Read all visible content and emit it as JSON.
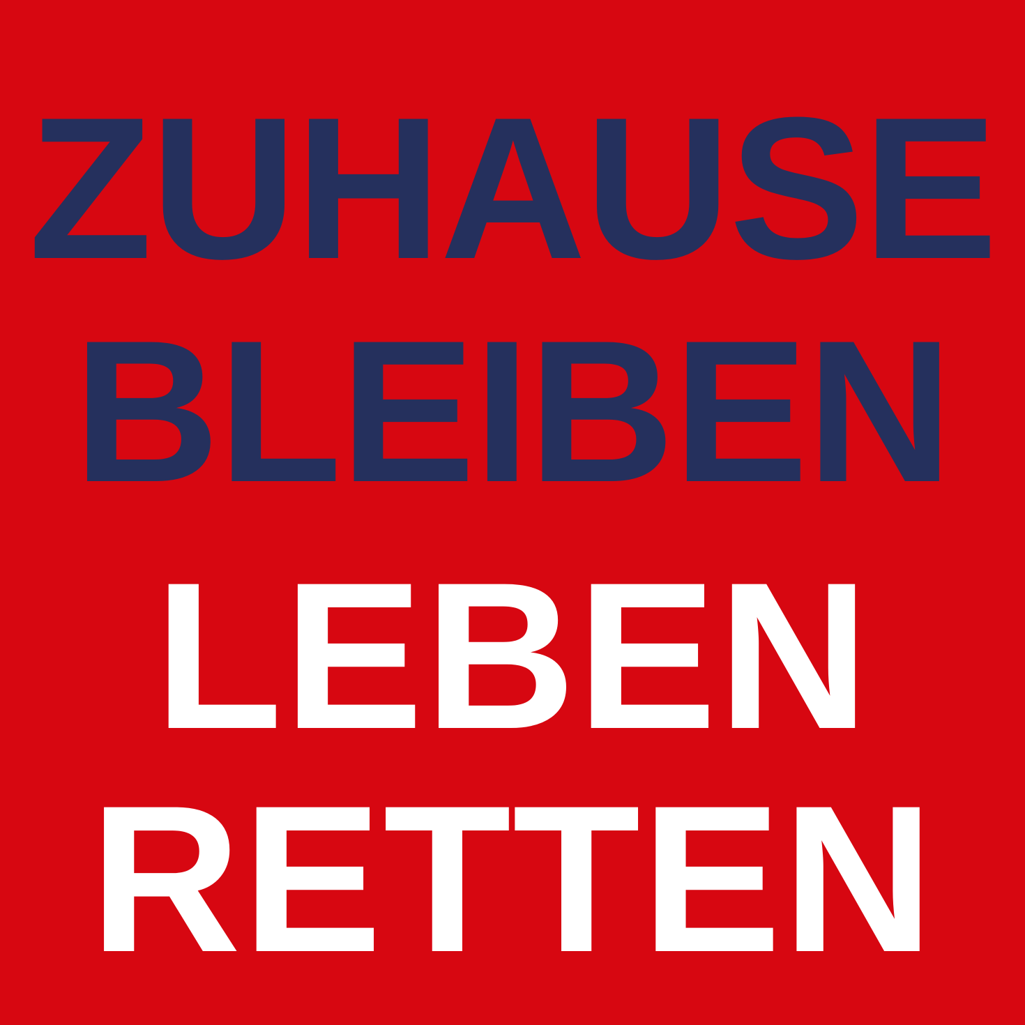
{
  "poster": {
    "background_color": "#d70711",
    "headline": {
      "color": "#25305d",
      "line1": "ZUHAUSE",
      "line2": "BLEIBEN"
    },
    "subline": {
      "color": "#ffffff",
      "line1": "LEBEN",
      "line2": "RETTEN"
    }
  }
}
